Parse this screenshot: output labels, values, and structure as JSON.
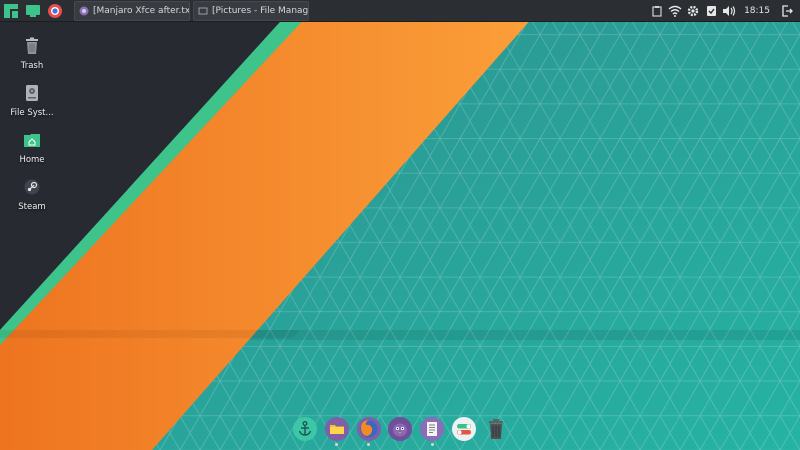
{
  "colors": {
    "panel": "#2b2e33",
    "accent_green": "#3ec48a",
    "orange": "#f07d20",
    "teal": "#2a9c95",
    "dark_slate": "#272b31"
  },
  "top_panel": {
    "menu_icon": "manjaro-logo-icon",
    "show_desktop_icon": "show-desktop-icon",
    "browser_icon": "chromium-icon",
    "tasks": [
      {
        "label": "[Manjaro Xfce after.txt - ...",
        "icon": "text-editor-icon"
      },
      {
        "label": "[Pictures - File Manager]",
        "icon": "file-manager-icon"
      }
    ],
    "tray": {
      "icons": [
        "clipboard-icon",
        "wifi-icon",
        "settings-gear-icon",
        "checklist-icon",
        "volume-icon"
      ],
      "clock": "18:15",
      "logout_icon": "logout-icon"
    }
  },
  "desktop_icons": [
    {
      "label": "Trash",
      "icon": "trash-icon"
    },
    {
      "label": "File Syst...",
      "icon": "file-system-icon"
    },
    {
      "label": "Home",
      "icon": "home-folder-icon"
    },
    {
      "label": "Steam",
      "icon": "steam-icon"
    }
  ],
  "dock": {
    "items": [
      {
        "name": "anchor-icon"
      },
      {
        "name": "file-manager-icon"
      },
      {
        "name": "firefox-icon"
      },
      {
        "name": "pidgin-icon"
      },
      {
        "name": "text-editor-icon"
      },
      {
        "name": "settings-toggle-icon"
      },
      {
        "name": "trash-icon"
      }
    ]
  }
}
